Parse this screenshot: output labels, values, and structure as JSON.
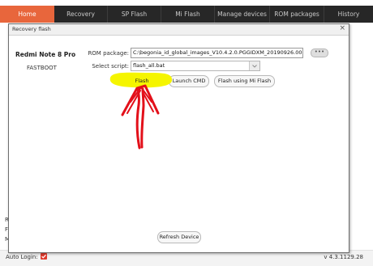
{
  "nav": {
    "tabs": [
      {
        "label": "Home"
      },
      {
        "label": "Recovery"
      },
      {
        "label": "SP Flash"
      },
      {
        "label": "Mi Flash"
      },
      {
        "label": "Manage devices"
      },
      {
        "label": "ROM packages"
      },
      {
        "label": "History"
      }
    ],
    "active_tab": "Home"
  },
  "background": {
    "left_letters": [
      "R",
      "F",
      "M"
    ]
  },
  "dialog": {
    "title": "Recovery flash",
    "close": "×",
    "device": {
      "name": "Redmi Note 8 Pro",
      "mode": "FASTBOOT"
    },
    "rom_package": {
      "label": "ROM package:",
      "value": "C:\\begonia_id_global_images_V10.4.2.0.PGGIDXM_20190926.0000...",
      "browse": "•••"
    },
    "script": {
      "label": "Select script:",
      "value": "flash_all.bat"
    },
    "buttons": {
      "flash": "Flash",
      "launch_cmd": "Launch CMD",
      "flash_mi": "Flash using Mi Flash",
      "refresh": "Refresh Device"
    }
  },
  "status": {
    "auto_login_label": "Auto Login:",
    "auto_login_checked": true,
    "version": "v 4.3.1129.28"
  },
  "colors": {
    "nav_bg": "#272727",
    "active_tab": "#e8663c",
    "highlight": "#f5f500",
    "annotation_arrow": "#e3101a",
    "checkbox": "#e03b2e"
  }
}
